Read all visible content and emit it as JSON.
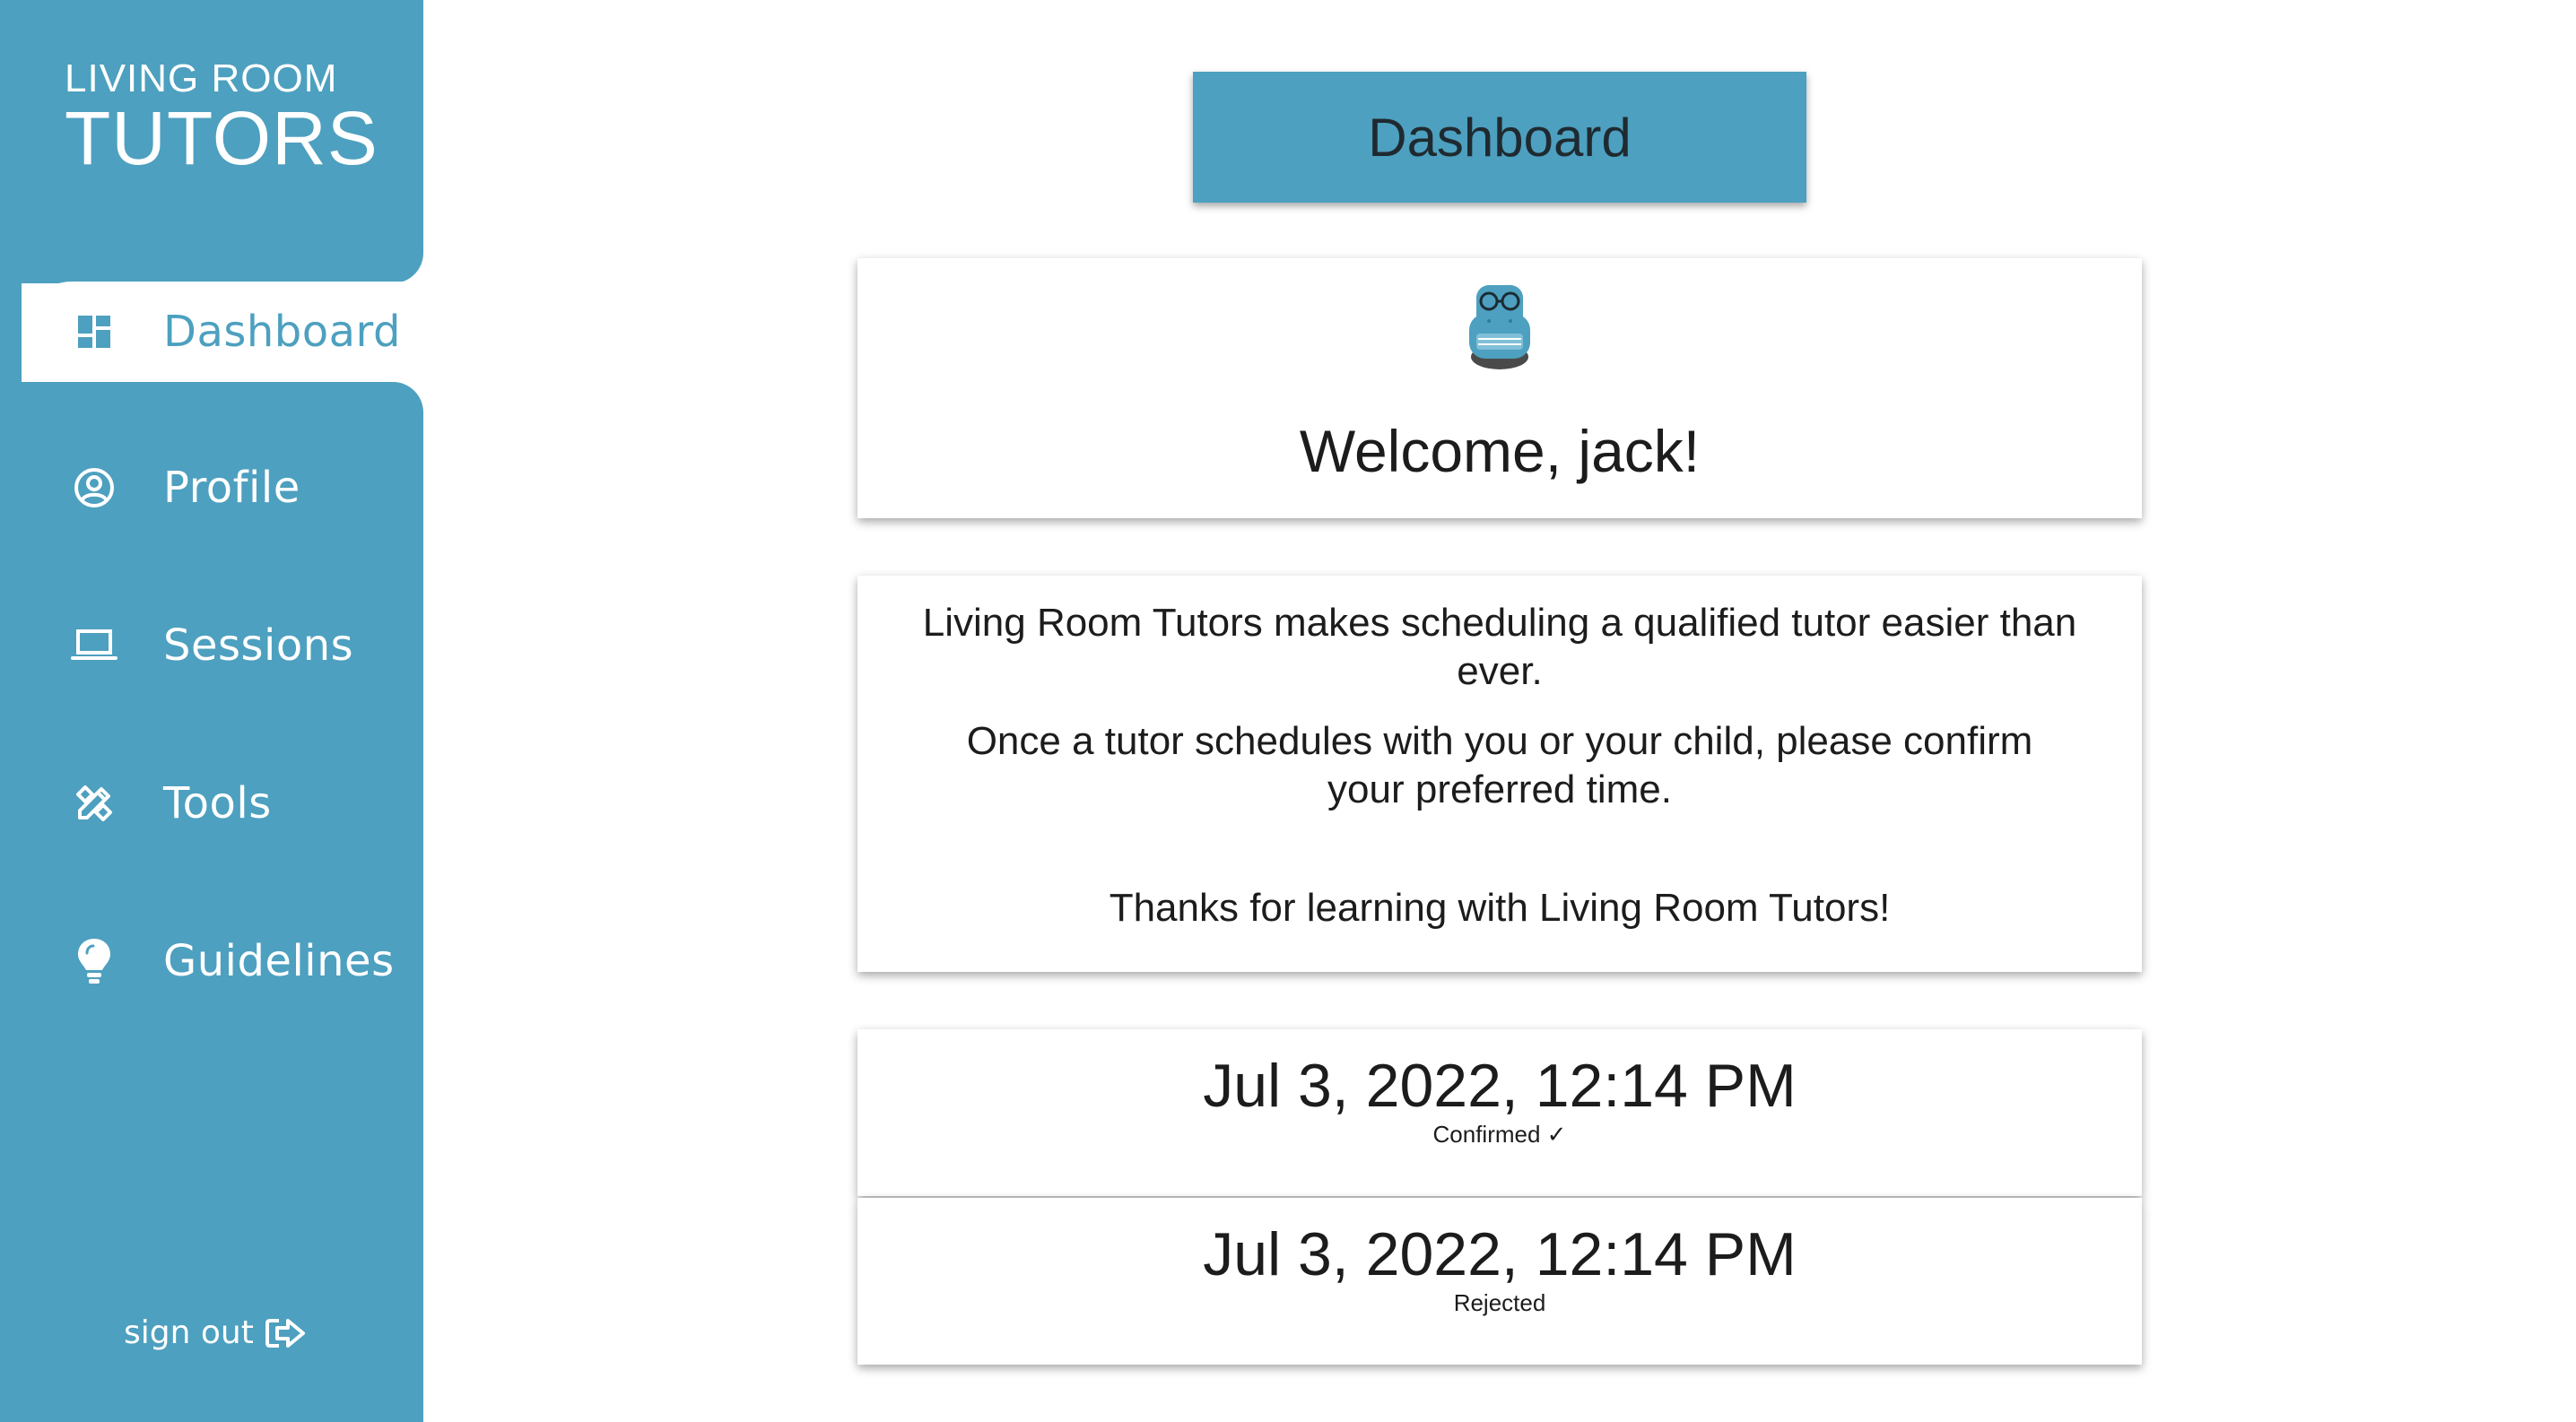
{
  "brand": {
    "line1": "LIVING ROOM",
    "line2": "TUTORS",
    "accent_color": "#4da0bf"
  },
  "nav": {
    "items": [
      {
        "label": "Dashboard",
        "icon": "dashboard-icon",
        "active": true
      },
      {
        "label": "Profile",
        "icon": "user-circle-icon",
        "active": false
      },
      {
        "label": "Sessions",
        "icon": "laptop-icon",
        "active": false
      },
      {
        "label": "Tools",
        "icon": "tools-icon",
        "active": false
      },
      {
        "label": "Guidelines",
        "icon": "lightbulb-icon",
        "active": false
      }
    ],
    "signout_label": "sign out",
    "signout_icon": "sign-out-icon"
  },
  "header": {
    "title": "Dashboard"
  },
  "welcome": {
    "avatar_icon": "owl-armchair-icon",
    "text": "Welcome, jack!"
  },
  "info": {
    "p1": "Living Room Tutors makes scheduling a qualified tutor easier than ever.",
    "p2": "Once a tutor schedules with you or your child, please confirm your preferred time.",
    "p3": "Thanks for learning with Living Room Tutors!"
  },
  "sessions": [
    {
      "datetime": "Jul 3, 2022, 12:14 PM",
      "status": "Confirmed ✓"
    },
    {
      "datetime": "Jul 3, 2022, 12:14 PM",
      "status": "Rejected"
    }
  ]
}
